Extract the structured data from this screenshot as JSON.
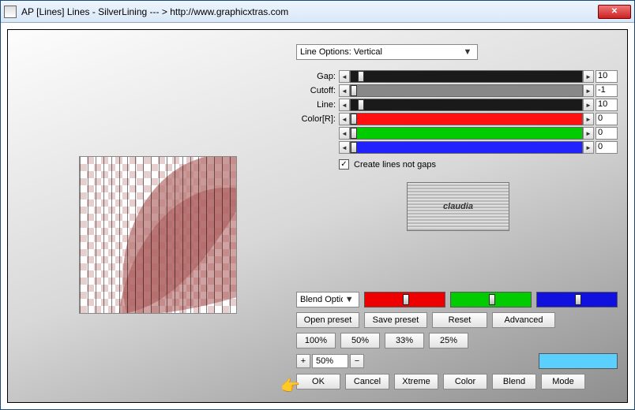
{
  "window": {
    "title": "AP [Lines]  Lines - SilverLining   --- > http://www.graphicxtras.com"
  },
  "dropdown": {
    "value": "Line Options: Vertical"
  },
  "sliders": [
    {
      "label": "Gap:",
      "color": "black",
      "value": "10",
      "thumb_pct": 3
    },
    {
      "label": "Cutoff:",
      "color": "gray",
      "value": "-1",
      "thumb_pct": 0
    },
    {
      "label": "Line:",
      "color": "black",
      "value": "10",
      "thumb_pct": 3
    },
    {
      "label": "Color[R]:",
      "color": "red",
      "value": "0",
      "thumb_pct": 0
    },
    {
      "label": "",
      "color": "green",
      "value": "0",
      "thumb_pct": 0
    },
    {
      "label": "",
      "color": "blue",
      "value": "0",
      "thumb_pct": 0
    }
  ],
  "checkbox": {
    "label": "Create lines not gaps",
    "checked": true
  },
  "logo_text": "claudia",
  "blend_dropdown": "Blend Options",
  "preset_row": {
    "open": "Open preset",
    "save": "Save preset",
    "reset": "Reset",
    "advanced": "Advanced"
  },
  "zoom_presets": [
    "100%",
    "50%",
    "33%",
    "25%"
  ],
  "zoom": {
    "plus": "+",
    "value": "50%",
    "minus": "−"
  },
  "action_row": [
    "OK",
    "Cancel",
    "Xtreme",
    "Color",
    "Blend",
    "Mode"
  ]
}
